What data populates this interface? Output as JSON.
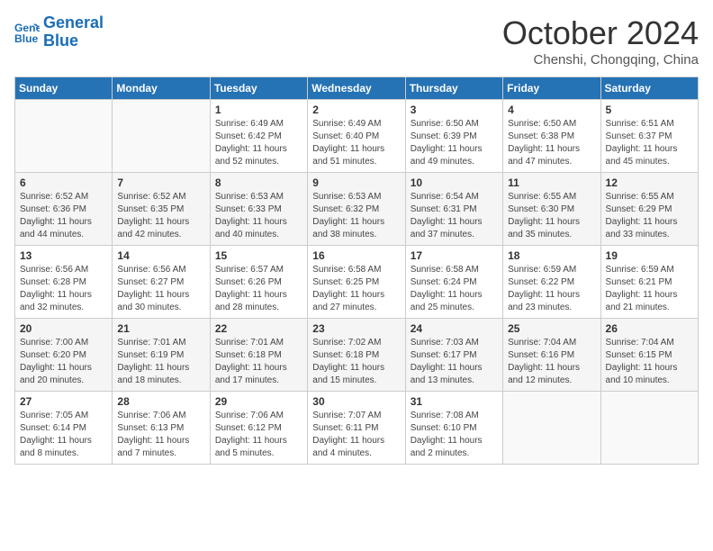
{
  "header": {
    "logo_line1": "General",
    "logo_line2": "Blue",
    "month_title": "October 2024",
    "subtitle": "Chenshi, Chongqing, China"
  },
  "days_of_week": [
    "Sunday",
    "Monday",
    "Tuesday",
    "Wednesday",
    "Thursday",
    "Friday",
    "Saturday"
  ],
  "weeks": [
    [
      {
        "day": "",
        "info": ""
      },
      {
        "day": "",
        "info": ""
      },
      {
        "day": "1",
        "info": "Sunrise: 6:49 AM\nSunset: 6:42 PM\nDaylight: 11 hours and 52 minutes."
      },
      {
        "day": "2",
        "info": "Sunrise: 6:49 AM\nSunset: 6:40 PM\nDaylight: 11 hours and 51 minutes."
      },
      {
        "day": "3",
        "info": "Sunrise: 6:50 AM\nSunset: 6:39 PM\nDaylight: 11 hours and 49 minutes."
      },
      {
        "day": "4",
        "info": "Sunrise: 6:50 AM\nSunset: 6:38 PM\nDaylight: 11 hours and 47 minutes."
      },
      {
        "day": "5",
        "info": "Sunrise: 6:51 AM\nSunset: 6:37 PM\nDaylight: 11 hours and 45 minutes."
      }
    ],
    [
      {
        "day": "6",
        "info": "Sunrise: 6:52 AM\nSunset: 6:36 PM\nDaylight: 11 hours and 44 minutes."
      },
      {
        "day": "7",
        "info": "Sunrise: 6:52 AM\nSunset: 6:35 PM\nDaylight: 11 hours and 42 minutes."
      },
      {
        "day": "8",
        "info": "Sunrise: 6:53 AM\nSunset: 6:33 PM\nDaylight: 11 hours and 40 minutes."
      },
      {
        "day": "9",
        "info": "Sunrise: 6:53 AM\nSunset: 6:32 PM\nDaylight: 11 hours and 38 minutes."
      },
      {
        "day": "10",
        "info": "Sunrise: 6:54 AM\nSunset: 6:31 PM\nDaylight: 11 hours and 37 minutes."
      },
      {
        "day": "11",
        "info": "Sunrise: 6:55 AM\nSunset: 6:30 PM\nDaylight: 11 hours and 35 minutes."
      },
      {
        "day": "12",
        "info": "Sunrise: 6:55 AM\nSunset: 6:29 PM\nDaylight: 11 hours and 33 minutes."
      }
    ],
    [
      {
        "day": "13",
        "info": "Sunrise: 6:56 AM\nSunset: 6:28 PM\nDaylight: 11 hours and 32 minutes."
      },
      {
        "day": "14",
        "info": "Sunrise: 6:56 AM\nSunset: 6:27 PM\nDaylight: 11 hours and 30 minutes."
      },
      {
        "day": "15",
        "info": "Sunrise: 6:57 AM\nSunset: 6:26 PM\nDaylight: 11 hours and 28 minutes."
      },
      {
        "day": "16",
        "info": "Sunrise: 6:58 AM\nSunset: 6:25 PM\nDaylight: 11 hours and 27 minutes."
      },
      {
        "day": "17",
        "info": "Sunrise: 6:58 AM\nSunset: 6:24 PM\nDaylight: 11 hours and 25 minutes."
      },
      {
        "day": "18",
        "info": "Sunrise: 6:59 AM\nSunset: 6:22 PM\nDaylight: 11 hours and 23 minutes."
      },
      {
        "day": "19",
        "info": "Sunrise: 6:59 AM\nSunset: 6:21 PM\nDaylight: 11 hours and 21 minutes."
      }
    ],
    [
      {
        "day": "20",
        "info": "Sunrise: 7:00 AM\nSunset: 6:20 PM\nDaylight: 11 hours and 20 minutes."
      },
      {
        "day": "21",
        "info": "Sunrise: 7:01 AM\nSunset: 6:19 PM\nDaylight: 11 hours and 18 minutes."
      },
      {
        "day": "22",
        "info": "Sunrise: 7:01 AM\nSunset: 6:18 PM\nDaylight: 11 hours and 17 minutes."
      },
      {
        "day": "23",
        "info": "Sunrise: 7:02 AM\nSunset: 6:18 PM\nDaylight: 11 hours and 15 minutes."
      },
      {
        "day": "24",
        "info": "Sunrise: 7:03 AM\nSunset: 6:17 PM\nDaylight: 11 hours and 13 minutes."
      },
      {
        "day": "25",
        "info": "Sunrise: 7:04 AM\nSunset: 6:16 PM\nDaylight: 11 hours and 12 minutes."
      },
      {
        "day": "26",
        "info": "Sunrise: 7:04 AM\nSunset: 6:15 PM\nDaylight: 11 hours and 10 minutes."
      }
    ],
    [
      {
        "day": "27",
        "info": "Sunrise: 7:05 AM\nSunset: 6:14 PM\nDaylight: 11 hours and 8 minutes."
      },
      {
        "day": "28",
        "info": "Sunrise: 7:06 AM\nSunset: 6:13 PM\nDaylight: 11 hours and 7 minutes."
      },
      {
        "day": "29",
        "info": "Sunrise: 7:06 AM\nSunset: 6:12 PM\nDaylight: 11 hours and 5 minutes."
      },
      {
        "day": "30",
        "info": "Sunrise: 7:07 AM\nSunset: 6:11 PM\nDaylight: 11 hours and 4 minutes."
      },
      {
        "day": "31",
        "info": "Sunrise: 7:08 AM\nSunset: 6:10 PM\nDaylight: 11 hours and 2 minutes."
      },
      {
        "day": "",
        "info": ""
      },
      {
        "day": "",
        "info": ""
      }
    ]
  ]
}
